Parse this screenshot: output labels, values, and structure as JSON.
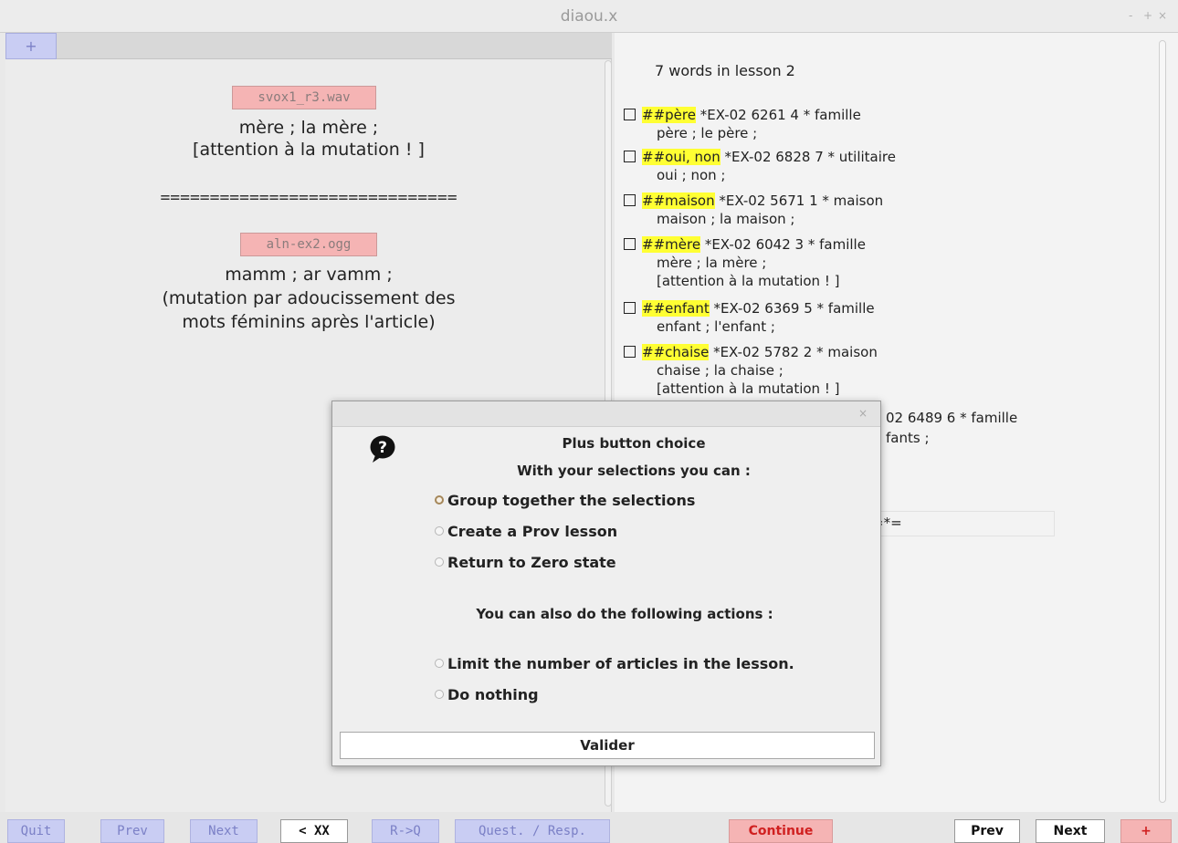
{
  "window": {
    "title": "diaou.x",
    "controls": [
      "-",
      "+",
      "×"
    ]
  },
  "left": {
    "tab_plus": "+",
    "audio1": "svox1_r3.wav",
    "text1_line1": "mère ; la mère ;",
    "text1_line2": "[attention à la mutation ! ]",
    "divider": "==============================",
    "audio2": "aln-ex2.ogg",
    "text2_line1": "mamm ; ar vamm ;",
    "text2_line2": "(mutation par adoucissement des",
    "text2_line3": "mots féminins après l'article)"
  },
  "right": {
    "header": "7  words in lesson  2",
    "entries": [
      {
        "tag": "##père",
        "rest": " *EX-02 6261  4 * famille",
        "sub": [
          "père ; le père ;"
        ]
      },
      {
        "tag": "##oui, non",
        "rest": " *EX-02 6828  7 * utilitaire",
        "sub": [
          "oui ; non ;"
        ]
      },
      {
        "tag": "##maison",
        "rest": " *EX-02 5671  1 * maison",
        "sub": [
          "maison ; la maison ;"
        ]
      },
      {
        "tag": "##mère",
        "rest": " *EX-02 6042  3 * famille",
        "sub": [
          "mère ; la mère ;",
          "[attention à la mutation ! ]"
        ]
      },
      {
        "tag": "##enfant",
        "rest": " *EX-02 6369  5 * famille",
        "sub": [
          "enfant ; l'enfant ;"
        ]
      },
      {
        "tag": "##chaise",
        "rest": " *EX-02 5782  2 * maison",
        "sub": [
          "chaise ; la chaise ;",
          "[attention à la mutation ! ]"
        ]
      }
    ],
    "partial_line1": "02 6489  6 * famille",
    "partial_line2": "fants ;",
    "partial_eq": "=*="
  },
  "bottom": {
    "quit": "Quit",
    "prev_left": "Prev",
    "next_left": "Next",
    "back_xx": "< XX",
    "r_to_q": "R->Q",
    "quest_resp": "Quest. / Resp.",
    "continue": "Continue",
    "prev_right": "Prev",
    "next_right": "Next",
    "plus": "+"
  },
  "dialog": {
    "close": "×",
    "title": "Plus button choice",
    "subtitle": "With your selections you can :",
    "options": [
      "Group together the selections",
      "Create a Prov lesson",
      "Return to Zero state"
    ],
    "selected_option": "Group together the selections",
    "also": "You can also do the following actions :",
    "actions": [
      "Limit the number of articles in the lesson.",
      "Do nothing"
    ],
    "validate": "Valider"
  },
  "colors": {
    "highlight": "#ffff33",
    "purple_button": "#c9cdf3",
    "red_button": "#f5b4b4"
  }
}
